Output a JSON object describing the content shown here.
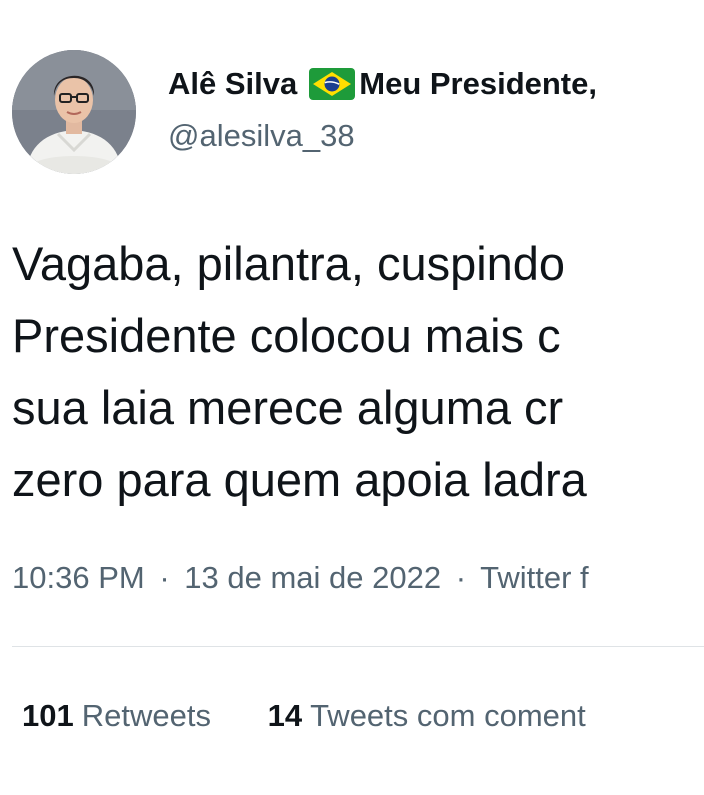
{
  "author": {
    "name": "Alê Silva",
    "flag_icon": "brazil-flag-icon",
    "name_suffix": "Meu Presidente, ",
    "handle": "@alesilva_38"
  },
  "tweet": {
    "lines": [
      "Vagaba, pilantra, cuspindo",
      "Presidente colocou mais c",
      "sua laia merece alguma cr",
      "zero para quem apoia ladra"
    ]
  },
  "meta": {
    "time": "10:36 PM",
    "separator": "·",
    "date": "13 de mai de 2022",
    "source": "Twitter f"
  },
  "stats": {
    "retweets_count": "101",
    "retweets_label": "Retweets",
    "quotes_count": "14",
    "quotes_label": "Tweets com coment"
  },
  "colors": {
    "text": "#0f1419",
    "secondary": "#536471",
    "divider": "#dfe3e6",
    "flag_green": "#1e9b3a",
    "flag_yellow": "#ffdf00",
    "flag_blue": "#1b3f8f"
  }
}
